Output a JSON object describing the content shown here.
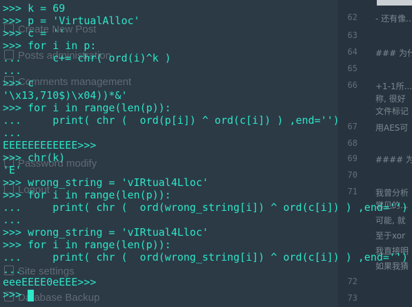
{
  "sidebar": {
    "items": [
      {
        "label": "Create New Post"
      },
      {
        "label": "Posts administration"
      },
      {
        "label": "Comments management"
      },
      {
        "label": "Password modify"
      },
      {
        "label": "Logout"
      },
      {
        "label": "Site settings"
      },
      {
        "label": "Database Backup"
      }
    ]
  },
  "editor": {
    "lines": [
      {
        "num": "62",
        "text": "- 还有像..."
      },
      {
        "num": "63",
        "text": ""
      },
      {
        "num": "64",
        "text": "### 为什..."
      },
      {
        "num": "65",
        "text": ""
      },
      {
        "num": "66",
        "text": "+1-1所..."
      },
      {
        "num": "",
        "text": "称, 很好"
      },
      {
        "num": "",
        "text": "文件标记"
      },
      {
        "num": "67",
        "text": "用AES可"
      },
      {
        "num": "68",
        "text": ""
      },
      {
        "num": "69",
        "text": "#### 为什"
      },
      {
        "num": "70",
        "text": ""
      },
      {
        "num": "71",
        "text": "我曾分析"
      },
      {
        "num": "",
        "text": "常见的..."
      },
      {
        "num": "",
        "text": "可能, 就"
      },
      {
        "num": "",
        "text": "至于xor"
      },
      {
        "num": "",
        "text": "我直接明"
      },
      {
        "num": "",
        "text": "如果我猜"
      },
      {
        "num": "72",
        "text": ""
      },
      {
        "num": "73",
        "text": ""
      }
    ]
  },
  "terminal": {
    "lines": [
      ">>> k = 69",
      ">>> p = 'VirtualAlloc'",
      ">>> c = ''",
      ">>> for i in p:",
      "...     c+= chr( ord(i)^k )",
      "...",
      ">>> c",
      "'\\x13,710$)\\x04))*&'",
      ">>> for i in range(len(p)):",
      "...     print( chr (  ord(p[i]) ^ ord(c[i]) ) ,end='')",
      "...",
      "EEEEEEEEEEEE>>>",
      ">>> chr(k)",
      "'E'",
      ">>> wrong_string = 'vIRtual4Lloc'",
      ">>> for i in range(len(p)):",
      "...     print( chr (  ord(wrong_string[i]) ^ ord(c[i]) ) ,end='')",
      "...",
      ">>> wrong_string = 'vIRtual4Lloc'",
      ">>> for i in range(len(p)):",
      "...     print( chr (  ord(wrong_string[i]) ^ ord(c[i]) ) ,end='')",
      "...",
      "eeeEEEE0eEEE>>>",
      ">>> "
    ]
  },
  "colors": {
    "terminal_text": "#2ee6c8",
    "background": "#2c3a46"
  }
}
